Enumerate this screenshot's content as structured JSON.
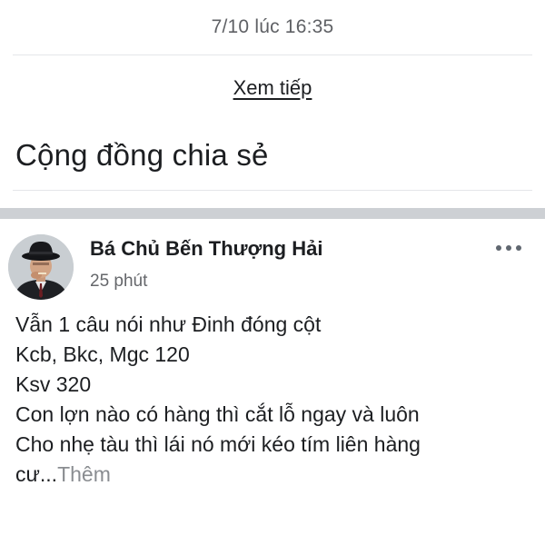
{
  "feed": {
    "timestamp": "7/10 lúc 16:35",
    "see_more": "Xem tiếp"
  },
  "section": {
    "title": "Cộng đồng chia sẻ"
  },
  "post": {
    "author": "Bá Chủ Bến Thượng Hải",
    "time": "25 phút",
    "more_options_icon": "more-horizontal-icon",
    "lines": [
      "Vẫn 1 câu nói như Đinh đóng cột",
      "Kcb, Bkc, Mgc 120",
      "Ksv 320",
      "Con lợn nào có hàng thì cắt lỗ ngay và luôn",
      "Cho nhẹ tàu thì lái nó mới kéo tím liên hàng",
      "cư..."
    ],
    "more_label": "Thêm"
  }
}
